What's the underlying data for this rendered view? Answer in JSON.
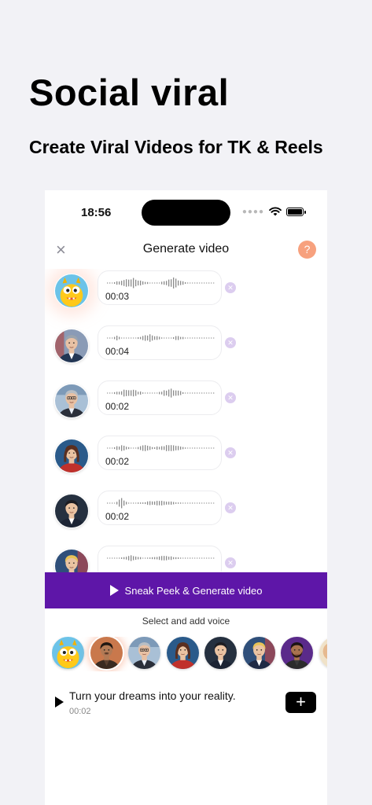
{
  "hero": {
    "title": "Social viral",
    "subtitle": "Create Viral Videos for TK & Reels"
  },
  "status_bar": {
    "time": "18:56",
    "icons": [
      "cellular-dots",
      "wifi-icon",
      "battery-icon"
    ]
  },
  "nav": {
    "title": "Generate video",
    "close_icon": "×",
    "help_icon": "?"
  },
  "clips": [
    {
      "avatar": "cartoon-monster-avatar",
      "duration": "00:03",
      "selected": true
    },
    {
      "avatar": "man-dark-suit-avatar",
      "duration": "00:04",
      "selected": false
    },
    {
      "avatar": "man-glasses-avatar",
      "duration": "00:02",
      "selected": false
    },
    {
      "avatar": "woman-red-avatar",
      "duration": "00:02",
      "selected": false
    },
    {
      "avatar": "man-dark-hair-avatar",
      "duration": "00:02",
      "selected": false
    },
    {
      "avatar": "man-blond-avatar",
      "duration": "",
      "selected": false
    }
  ],
  "generate_button": {
    "label": "Sneak Peek & Generate video"
  },
  "voice_picker": {
    "label": "Select and add voice",
    "voices": [
      "cartoon-monster-avatar",
      "man-mustache-avatar",
      "man-glasses-avatar",
      "woman-red-avatar",
      "man-dark-hair-avatar",
      "man-blond-avatar",
      "man-beard-avatar",
      "partial-avatar"
    ],
    "selected_index": 1
  },
  "preview": {
    "text": "Turn your dreams into your reality.",
    "duration": "00:02",
    "add_icon": "+"
  },
  "colors": {
    "accent": "#5e16a8",
    "help": "#f7a17e",
    "remove": "#dccdef",
    "background": "#f2f2f6"
  }
}
